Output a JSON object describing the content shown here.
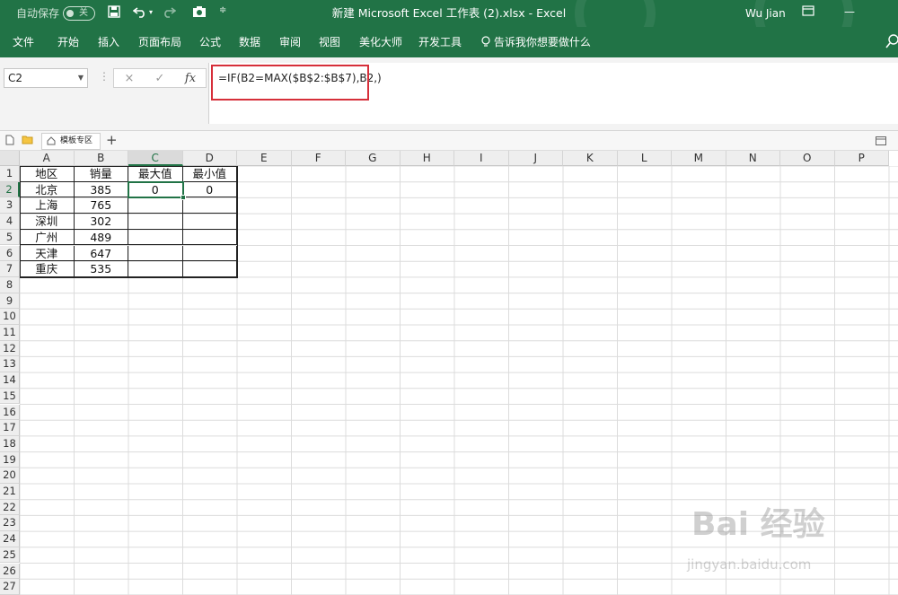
{
  "titlebar": {
    "autosave_label": "自动保存",
    "autosave_toggle": "关",
    "title": "新建 Microsoft Excel 工作表 (2).xlsx  -  Excel",
    "user": "Wu Jian"
  },
  "menu": {
    "items": [
      "文件",
      "开始",
      "插入",
      "页面布局",
      "公式",
      "数据",
      "审阅",
      "视图",
      "美化大师",
      "开发工具"
    ],
    "tell_me": "告诉我你想要做什么"
  },
  "formula_bar": {
    "name_box": "C2",
    "cancel_icon": "×",
    "enter_icon": "✓",
    "fx_label": "fx",
    "formula": "=IF(B2=MAX($B$2:$B$7),B2,)"
  },
  "tabstrip": {
    "tab_label": "模板专区",
    "add": "+"
  },
  "grid": {
    "columns": [
      "A",
      "B",
      "C",
      "D",
      "E",
      "F",
      "G",
      "H",
      "I",
      "J",
      "K",
      "L",
      "M",
      "N",
      "O",
      "P"
    ],
    "rows": [
      "1",
      "2",
      "3",
      "4",
      "5",
      "6",
      "7",
      "8",
      "9",
      "10",
      "11",
      "12",
      "13",
      "14",
      "15",
      "16",
      "17",
      "18",
      "19",
      "20",
      "21",
      "22",
      "23",
      "24",
      "25",
      "26",
      "27",
      "28"
    ],
    "active_column": "C",
    "active_row": "2",
    "data": [
      [
        "地区",
        "销量",
        "最大值",
        "最小值"
      ],
      [
        "北京",
        "385",
        "0",
        "0"
      ],
      [
        "上海",
        "765",
        "",
        ""
      ],
      [
        "深圳",
        "302",
        "",
        ""
      ],
      [
        "广州",
        "489",
        "",
        ""
      ],
      [
        "天津",
        "647",
        "",
        ""
      ],
      [
        "重庆",
        "535",
        "",
        ""
      ]
    ]
  },
  "watermark": {
    "main": "Bai 经验",
    "sub": "jingyan.baidu.com"
  }
}
